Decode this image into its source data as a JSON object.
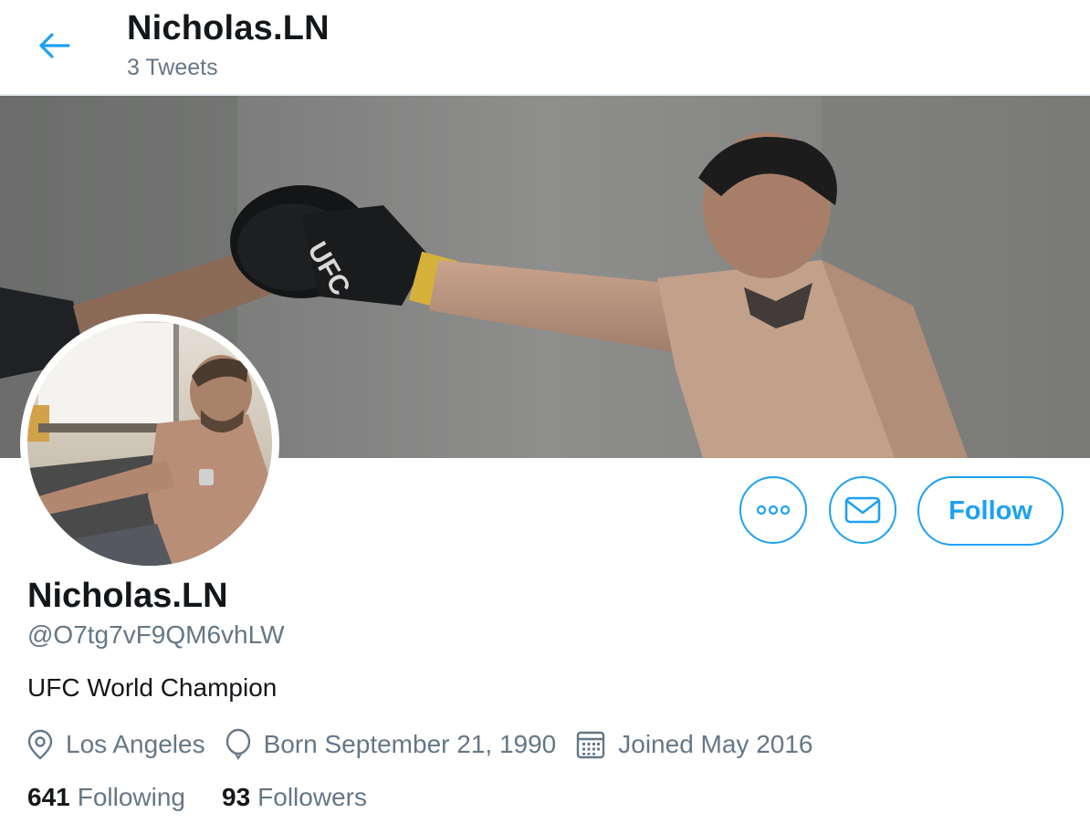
{
  "header": {
    "back_icon": "arrow-left-icon",
    "name": "Nicholas.LN",
    "tweet_count": "3 Tweets"
  },
  "banner": {
    "description_icon": "banner-photo",
    "printed_text": "UFC"
  },
  "actions": {
    "more_icon": "more-dots-icon",
    "message_icon": "envelope-icon",
    "follow_label": "Follow"
  },
  "profile": {
    "display_name": "Nicholas.LN",
    "handle": "@O7tg7vF9QM6vhLW",
    "bio": "UFC World Champion",
    "location": "Los Angeles",
    "birthday": "Born September 21, 1990",
    "joined": "Joined May 2016",
    "following_count": "641",
    "following_label": "Following",
    "followers_count": "93",
    "followers_label": "Followers"
  },
  "colors": {
    "accent": "#1da1f2",
    "text_primary": "#14171a",
    "text_secondary": "#657786",
    "divider": "#e6ecf0"
  }
}
